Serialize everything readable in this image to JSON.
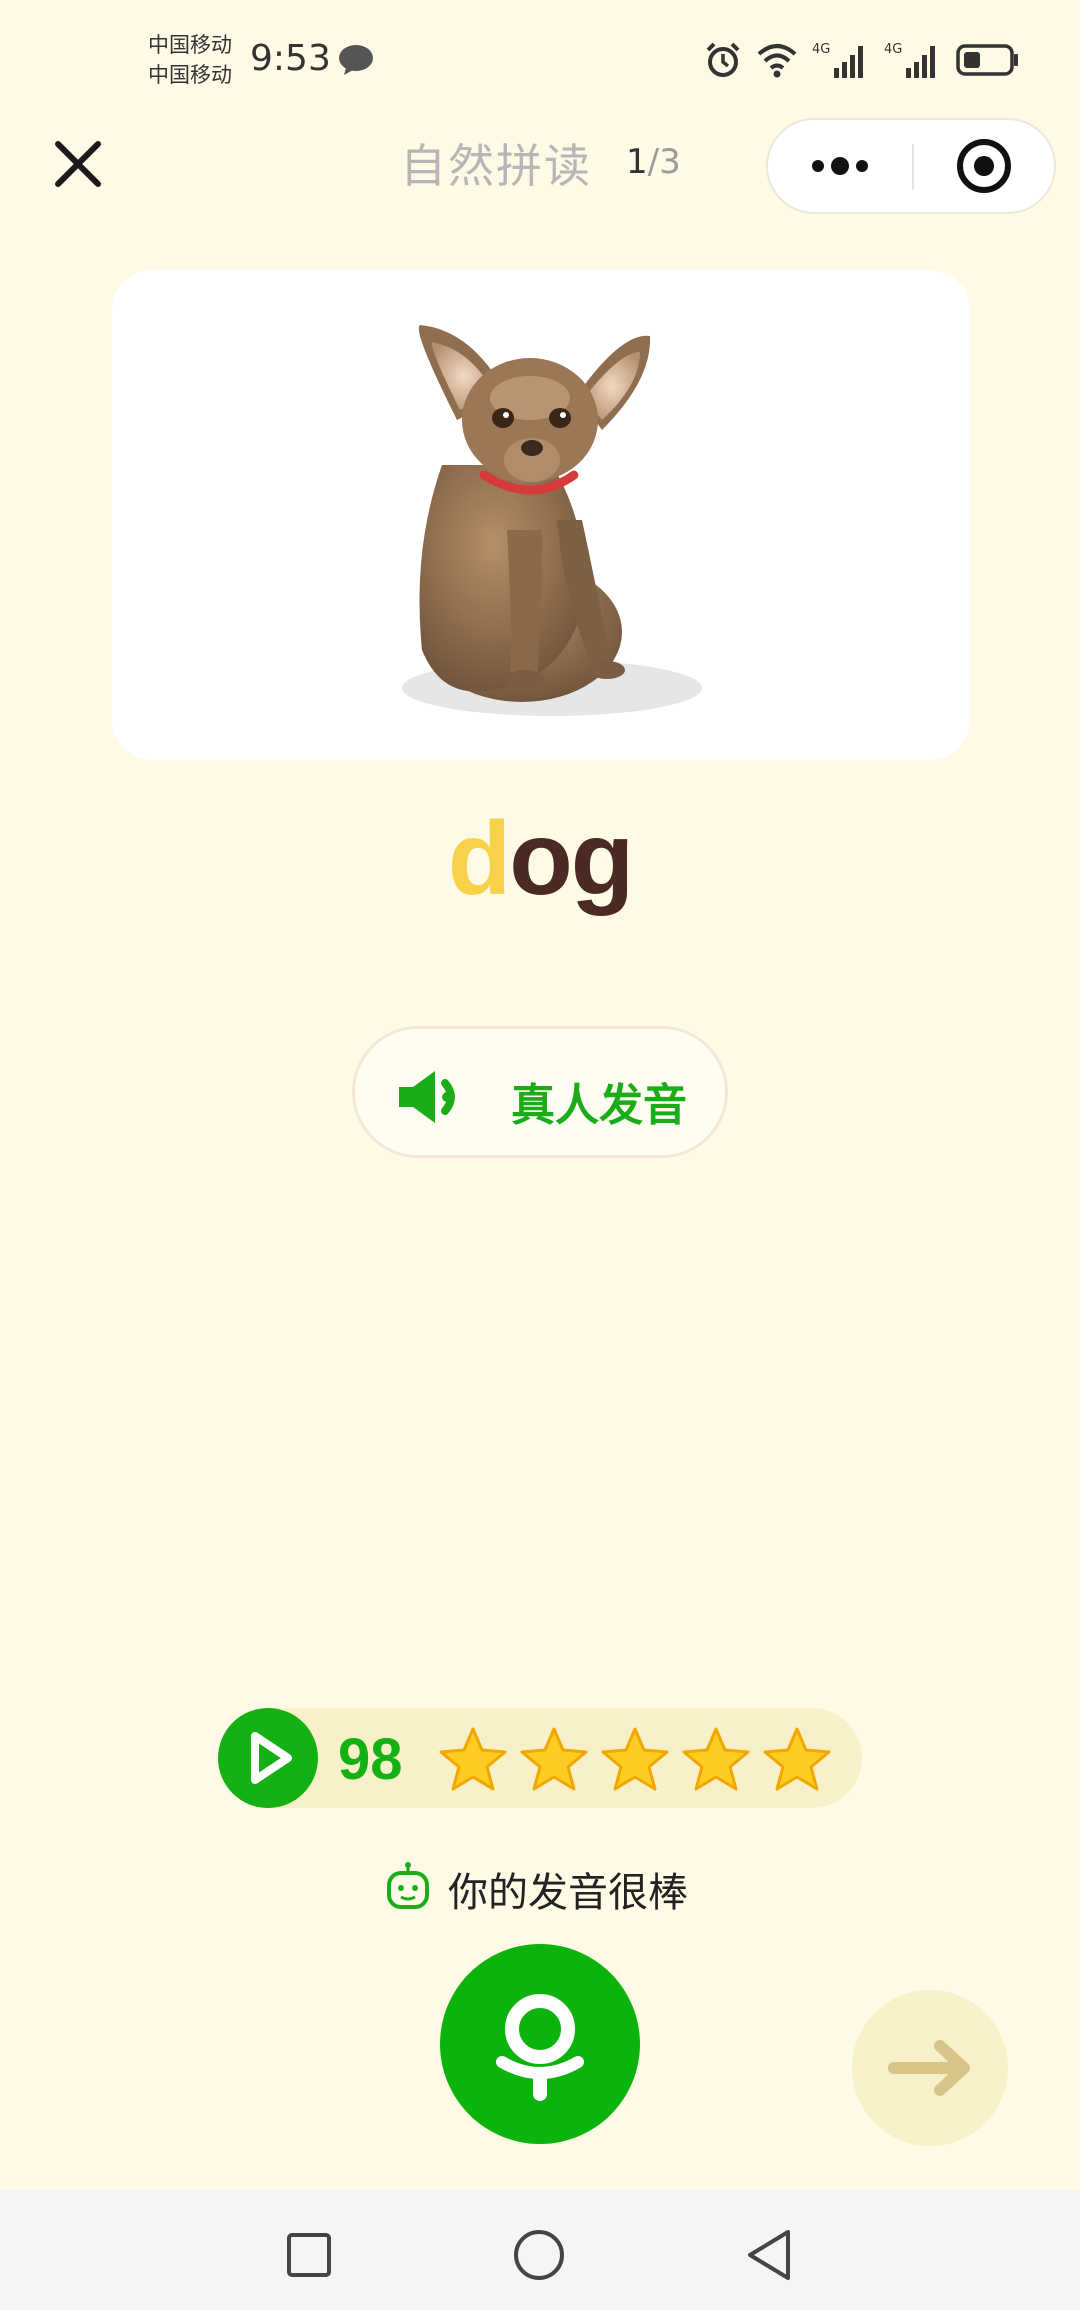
{
  "status_bar": {
    "carrier_1": "中国移动",
    "carrier_2": "中国移动",
    "time": "9:53",
    "icons": [
      "chat-bubble-icon",
      "alarm-icon",
      "wifi-icon",
      "signal-4g-icon",
      "signal-4g-icon",
      "battery-icon"
    ],
    "network_label": "4G"
  },
  "header": {
    "title": "自然拼读",
    "progress_current": "1",
    "progress_separator": "/",
    "progress_total": "3",
    "icons": [
      "close-icon",
      "more-icon",
      "target-icon"
    ]
  },
  "card": {
    "image_icon": "chihuahua-dog-illustration"
  },
  "word": {
    "highlight": "d",
    "rest": "og"
  },
  "pronounce": {
    "label": "真人发音",
    "icon": "speaker-icon"
  },
  "result": {
    "score": "98",
    "stars": 5,
    "feedback": "你的发音很棒",
    "play_icon": "play-icon",
    "feedback_icon": "robot-icon"
  },
  "controls": {
    "mic_icon": "microphone-icon",
    "next_icon": "arrow-right-icon"
  },
  "colors": {
    "background": "#fefae6",
    "accent_green": "#14b014",
    "highlight_yellow": "#f7d147",
    "word_brown": "#4a2a22",
    "star_yellow": "#ffcc22"
  }
}
